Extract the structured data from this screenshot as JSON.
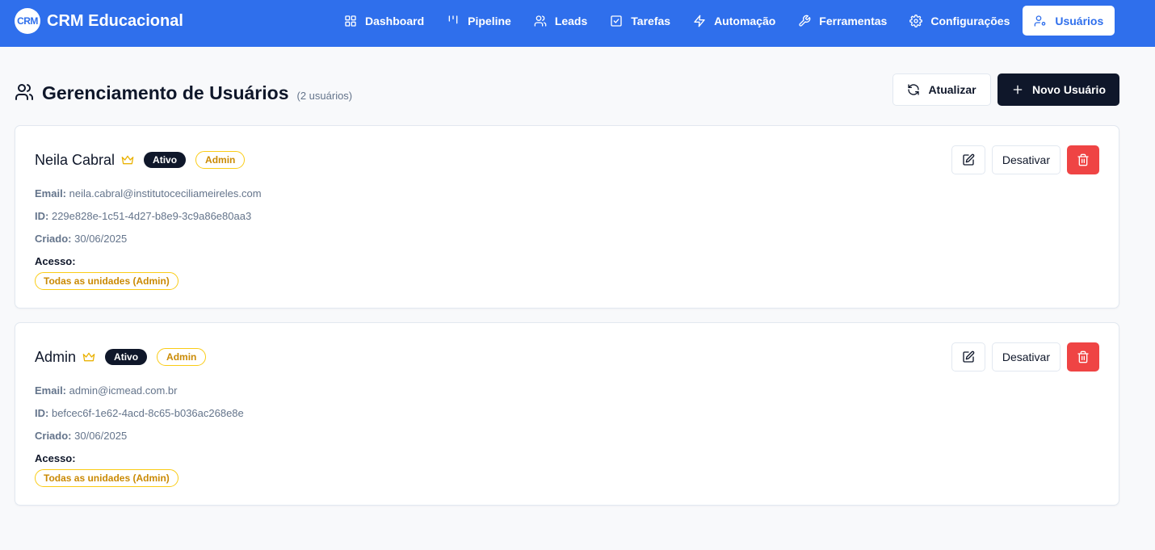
{
  "app": {
    "logo_text": "CRM",
    "name": "CRM Educacional"
  },
  "nav": {
    "items": [
      {
        "label": "Dashboard",
        "icon": "grid-icon"
      },
      {
        "label": "Pipeline",
        "icon": "pipeline-icon"
      },
      {
        "label": "Leads",
        "icon": "users-icon"
      },
      {
        "label": "Tarefas",
        "icon": "checkbox-icon"
      },
      {
        "label": "Automação",
        "icon": "lightning-icon"
      },
      {
        "label": "Ferramentas",
        "icon": "wrench-icon"
      },
      {
        "label": "Configurações",
        "icon": "gear-icon"
      },
      {
        "label": "Usuários",
        "icon": "user-cog-icon",
        "active": true
      }
    ]
  },
  "header": {
    "title": "Gerenciamento de Usuários",
    "count": "(2 usuários)",
    "refresh_label": "Atualizar",
    "new_user_label": "Novo Usuário"
  },
  "labels": {
    "email": "Email:",
    "id": "ID:",
    "created": "Criado:",
    "access": "Acesso:",
    "deactivate": "Desativar"
  },
  "users": [
    {
      "name": "Neila Cabral",
      "status": "Ativo",
      "role": "Admin",
      "email": "neila.cabral@institutoceciliameireles.com",
      "id": "229e828e-1c51-4d27-b8e9-3c9a86e80aa3",
      "created": "30/06/2025",
      "access": "Todas as unidades (Admin)"
    },
    {
      "name": "Admin",
      "status": "Ativo",
      "role": "Admin",
      "email": "admin@icmead.com.br",
      "id": "befcec6f-1e62-4acd-8c65-b036ac268e8e",
      "created": "30/06/2025",
      "access": "Todas as unidades (Admin)"
    }
  ],
  "colors": {
    "navbar": "#2f6fec",
    "primary_dark": "#0f172a",
    "danger": "#ef4444",
    "admin_accent": "#ca8a04"
  }
}
